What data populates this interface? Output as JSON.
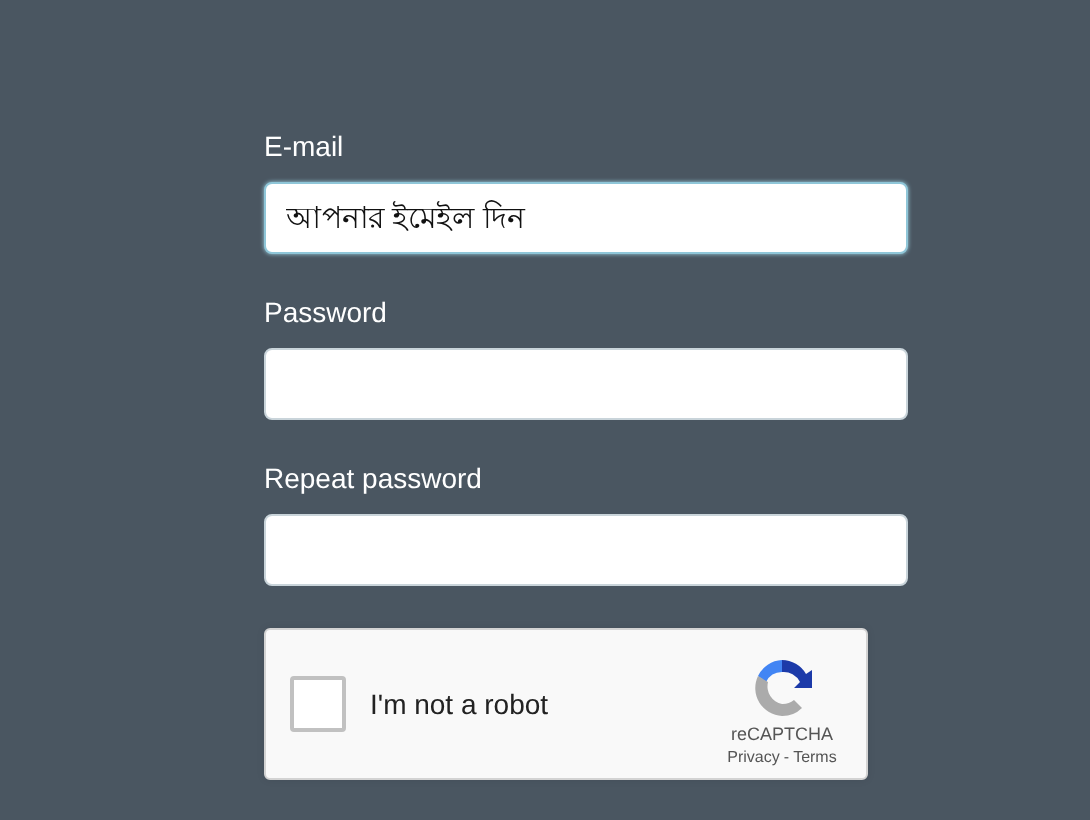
{
  "form": {
    "fields": [
      {
        "label": "E-mail",
        "value": "আপনার ইমেইল দিন",
        "focused": true
      },
      {
        "label": "Password",
        "focused": false
      },
      {
        "label": "Repeat password",
        "focused": false
      }
    ],
    "captcha": {
      "label": "I'm not a robot",
      "checked": false,
      "brand": "reCAPTCHA",
      "privacy": "Privacy",
      "separator": "-",
      "terms": "Terms"
    }
  }
}
